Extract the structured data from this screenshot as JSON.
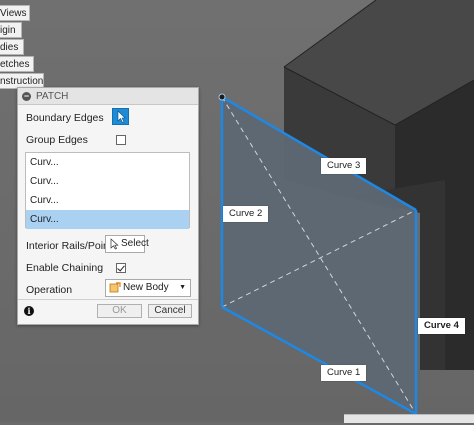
{
  "browser_tree": {
    "items": [
      "Views",
      "igin",
      "dies",
      "etches",
      "nstruction"
    ]
  },
  "patch_dialog": {
    "title": "PATCH",
    "boundary_edges_label": "Boundary Edges",
    "group_edges_label": "Group Edges",
    "group_edges_checked": false,
    "curves": [
      "Curv...",
      "Curv...",
      "Curv...",
      "Curv..."
    ],
    "selected_curve_index": 3,
    "interior_rails_label": "Interior Rails/Points",
    "select_button_label": "Select",
    "enable_chaining_label": "Enable Chaining",
    "enable_chaining_checked": true,
    "operation_label": "Operation",
    "operation_value": "New Body",
    "ok_label": "OK",
    "cancel_label": "Cancel"
  },
  "viewport": {
    "curve_labels": {
      "curve3": "Curve 3",
      "curve2": "Curve 2",
      "curve4": "Curve 4",
      "curve1": "Curve 1"
    },
    "colors": {
      "background": "#6b6b6b",
      "patch_fill": "#5b6670",
      "edge_highlight": "#1e88e5",
      "box_top": "#4a4a4a",
      "box_front": "#3b3b3b",
      "box_side": "#2d2d2d"
    }
  }
}
